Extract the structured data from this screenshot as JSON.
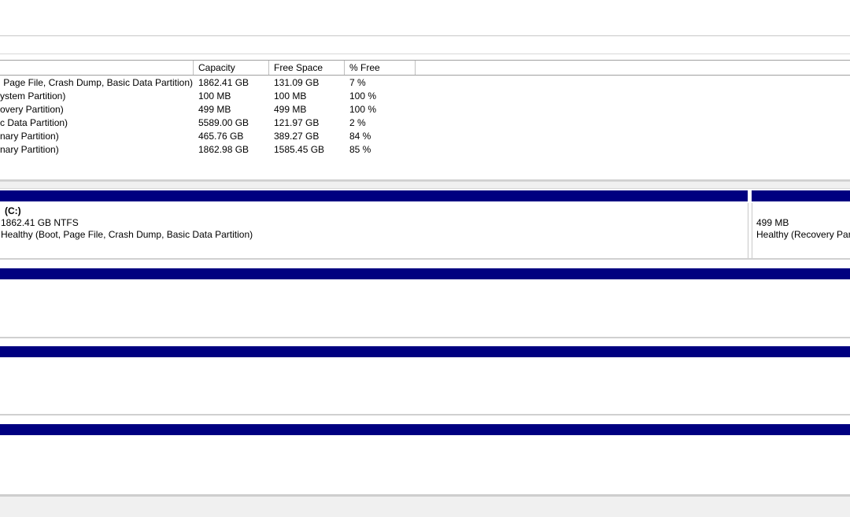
{
  "volume_list": {
    "headers": {
      "capacity": "Capacity",
      "free_space": "Free Space",
      "pct_free": "% Free"
    },
    "rows": [
      {
        "layout": "t, Page File, Crash Dump, Basic Data Partition)",
        "capacity": "1862.41 GB",
        "free": "131.09 GB",
        "pct": "7 %"
      },
      {
        "layout": "ystem Partition)",
        "capacity": "100 MB",
        "free": "100 MB",
        "pct": "100 %"
      },
      {
        "layout": "overy Partition)",
        "capacity": "499 MB",
        "free": "499 MB",
        "pct": "100 %"
      },
      {
        "layout": "c Data Partition)",
        "capacity": "5589.00 GB",
        "free": "121.97 GB",
        "pct": "2 %"
      },
      {
        "layout": "nary Partition)",
        "capacity": "465.76 GB",
        "free": "389.27 GB",
        "pct": "84 %"
      },
      {
        "layout": "nary Partition)",
        "capacity": "1862.98 GB",
        "free": "1585.45 GB",
        "pct": "85 %"
      }
    ]
  },
  "disk0": {
    "partition_c": {
      "name": "(C:)",
      "size": "1862.41 GB NTFS",
      "status": "Healthy (Boot, Page File, Crash Dump, Basic Data Partition)"
    },
    "partition_recovery": {
      "size": "499 MB",
      "status": "Healthy (Recovery Part"
    }
  },
  "colors": {
    "disk_bar": "#000080",
    "border": "#d0d0d0",
    "background": "#ffffff"
  }
}
